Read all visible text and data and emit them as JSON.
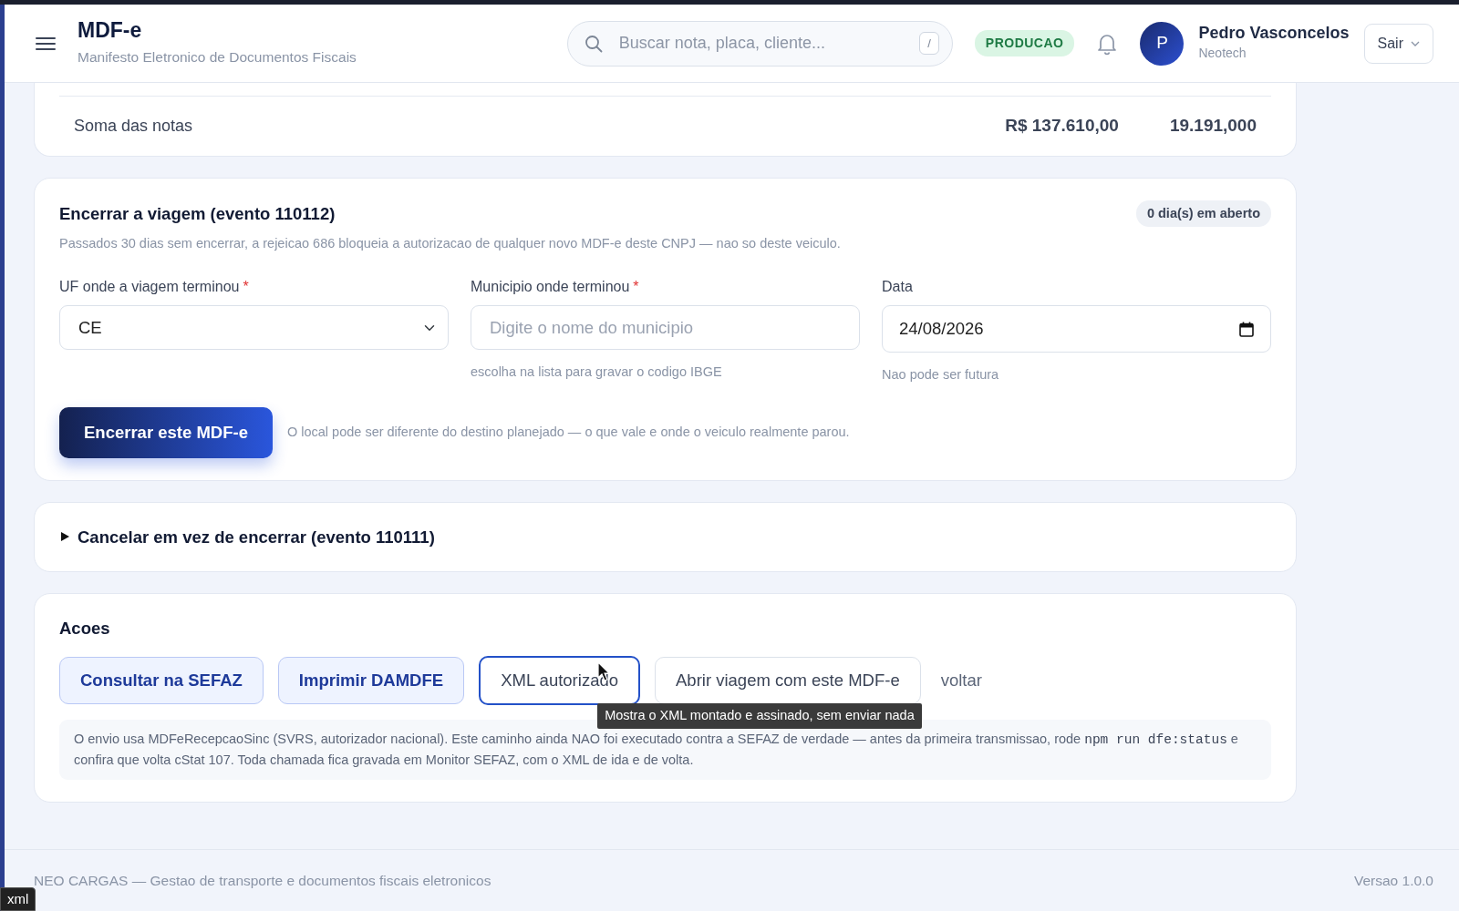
{
  "header": {
    "title": "MDF-e",
    "subtitle": "Manifesto Eletronico de Documentos Fiscais",
    "search": {
      "placeholder": "Buscar nota, placa, cliente...",
      "shortcut": "/"
    },
    "environment": "PRODUCAO",
    "user": {
      "initial": "P",
      "name": "Pedro Vasconcelos",
      "company": "Neotech"
    },
    "logout": "Sair"
  },
  "totals": {
    "label": "Soma das notas",
    "value": "R$ 137.610,00",
    "weight": "19.191,000"
  },
  "close_trip": {
    "title": "Encerrar a viagem (evento 110112)",
    "badge": "0 dia(s) em aberto",
    "note": "Passados 30 dias sem encerrar, a rejeicao 686 bloqueia a autorizacao de qualquer novo MDF-e deste CNPJ — nao so deste veiculo.",
    "fields": [
      {
        "kind": "select",
        "label": "UF onde a viagem terminou",
        "required_mark": "*",
        "value": "CE"
      },
      {
        "kind": "text",
        "label": "Municipio onde terminou",
        "required_mark": "*",
        "placeholder": "Digite o nome do municipio",
        "help": "escolha na lista para gravar o codigo IBGE"
      },
      {
        "kind": "date",
        "label": "Data",
        "value": "24/08/2026",
        "help": "Nao pode ser futura"
      }
    ],
    "button": "Encerrar este MDF-e",
    "hint": "O local pode ser diferente do destino planejado — o que vale e onde o veiculo realmente parou."
  },
  "cancel": {
    "title": "Cancelar em vez de encerrar (evento 110111)",
    "expanded": false
  },
  "actions": {
    "title": "Acoes",
    "buttons": [
      {
        "label": "Consultar na SEFAZ",
        "kind": "soft"
      },
      {
        "label": "Imprimir DAMDFE",
        "kind": "soft"
      },
      {
        "label": "XML autorizado",
        "kind": "focus"
      },
      {
        "label": "Abrir viagem com este MDF-e",
        "kind": "outline"
      },
      {
        "label": "voltar",
        "kind": "link"
      }
    ],
    "tooltip": "Mostra o XML montado e assinado, sem enviar nada",
    "note": [
      {
        "kind": "text",
        "text": "O envio usa MDFeRecepcaoSinc (SVRS, autorizador nacional). Este caminho ainda NAO foi executado contra a SEFAZ de verdade — antes da primeira transmissao, rode "
      },
      {
        "kind": "code",
        "text": "npm run dfe:status"
      },
      {
        "kind": "text",
        "text": " e confira que volta cStat 107. Toda chamada fica gravada em Monitor SEFAZ, com o XML de ida e de volta."
      }
    ]
  },
  "footer": {
    "text": "NEO CARGAS — Gestao de transporte e documentos fiscais eletronicos",
    "version": "Versao 1.0.0"
  },
  "status_url": "xml"
}
